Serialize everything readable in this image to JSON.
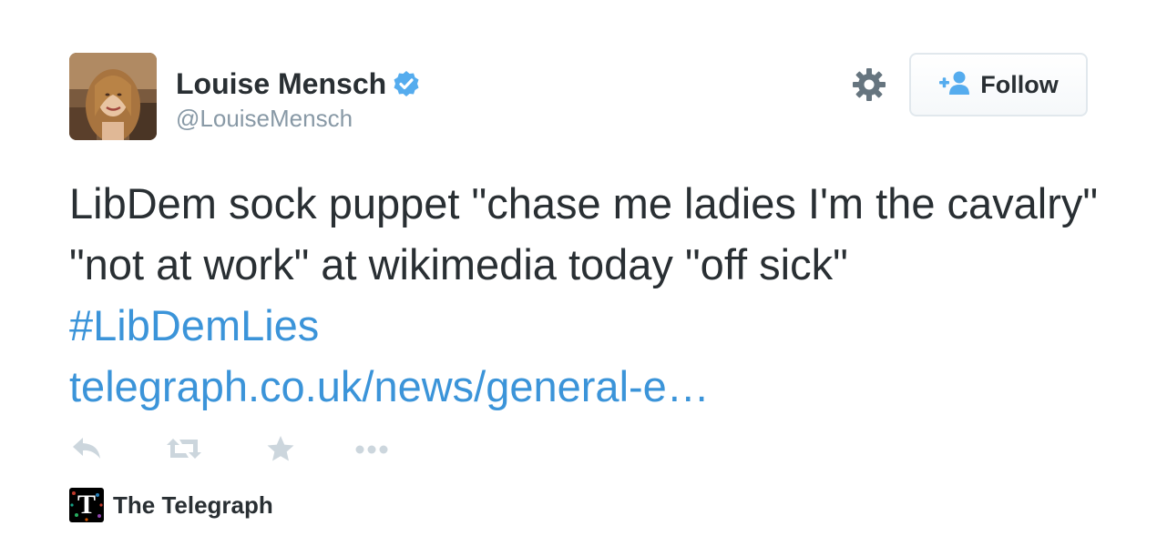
{
  "author": {
    "name": "Louise Mensch",
    "handle": "@LouiseMensch",
    "verified": true
  },
  "follow_button": {
    "label": "Follow"
  },
  "tweet": {
    "text_plain": "LibDem sock puppet \"chase me ladies I'm the cavalry\" \"not at work\" at wikimedia today \"off sick\"",
    "hashtag": "#LibDemLies",
    "link": "telegraph.co.uk/news/general-e…"
  },
  "actions": {
    "icons": [
      "reply-icon",
      "retweet-icon",
      "favorite-icon",
      "more-icon"
    ]
  },
  "source": {
    "logo_glyph": "T",
    "name": "The Telegraph"
  },
  "colors": {
    "link": "#3b94d9",
    "text": "#292f33",
    "muted": "#8899a6",
    "verified": "#55acee",
    "icon": "#ccd6dd"
  }
}
